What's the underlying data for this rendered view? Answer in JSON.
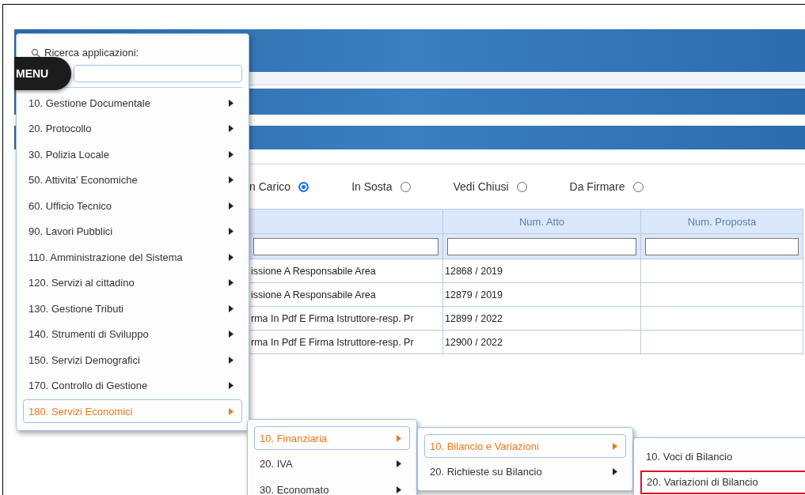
{
  "menu_badge": "MENU",
  "search": {
    "label": "Ricerca applicazioni:"
  },
  "filters": [
    {
      "label": "n Carico",
      "selected": true
    },
    {
      "label": "In Sosta",
      "selected": false
    },
    {
      "label": "Vedi Chiusi",
      "selected": false
    },
    {
      "label": "Da Firmare",
      "selected": false
    }
  ],
  "table": {
    "columns": [
      "Num. Atto",
      "Num. Proposta"
    ],
    "rows": [
      {
        "column_1": "issione A Responsabile Area",
        "num_atto": "12868 / 2019"
      },
      {
        "column_1": "issione A Responsabile Area",
        "num_atto": "12879 / 2019"
      },
      {
        "column_1": "rma In Pdf E Firma Istruttore-resp. Pr",
        "num_atto": "12899 / 2022"
      },
      {
        "column_1": "rma In Pdf E Firma Istruttore-resp. Pr",
        "num_atto": "12900 / 2022"
      }
    ]
  },
  "menus": [
    {
      "items": [
        {
          "label": "10. Gestione Documentale",
          "selected": false,
          "submenu": true,
          "outlined": false
        },
        {
          "label": "20. Protocollo",
          "selected": false,
          "submenu": true,
          "outlined": false
        },
        {
          "label": "30. Polizia Locale",
          "selected": false,
          "submenu": true,
          "outlined": false
        },
        {
          "label": "50. Attivita' Economiche",
          "selected": false,
          "submenu": true,
          "outlined": false
        },
        {
          "label": "60. Ufficio Tecnico",
          "selected": false,
          "submenu": true,
          "outlined": false
        },
        {
          "label": "90. Lavori Pubblici",
          "selected": false,
          "submenu": true,
          "outlined": false
        },
        {
          "label": "110. Amministrazione del Sistema",
          "selected": false,
          "submenu": true,
          "outlined": false
        },
        {
          "label": "120. Servizi al cittadino",
          "selected": false,
          "submenu": true,
          "outlined": false
        },
        {
          "label": "130. Gestione Tributi",
          "selected": false,
          "submenu": true,
          "outlined": false
        },
        {
          "label": "140. Strumenti di Sviluppo",
          "selected": false,
          "submenu": true,
          "outlined": false
        },
        {
          "label": "150. Servizi Demografici",
          "selected": false,
          "submenu": true,
          "outlined": false
        },
        {
          "label": "170. Controllo di Gestione",
          "selected": false,
          "submenu": true,
          "outlined": false
        },
        {
          "label": "180. Servizi Economici",
          "selected": true,
          "submenu": true,
          "outlined": false
        }
      ]
    },
    {
      "items": [
        {
          "label": "10. Finanziaria",
          "selected": true,
          "submenu": true,
          "outlined": false
        },
        {
          "label": "20. IVA",
          "selected": false,
          "submenu": true,
          "outlined": false
        },
        {
          "label": "30. Economato",
          "selected": false,
          "submenu": true,
          "outlined": false
        }
      ]
    },
    {
      "items": [
        {
          "label": "10. Bilancio e Variazioni",
          "selected": true,
          "submenu": true,
          "outlined": false
        },
        {
          "label": "20. Richieste su Bilancio",
          "selected": false,
          "submenu": true,
          "outlined": false
        }
      ]
    },
    {
      "items": [
        {
          "label": "10. Voci di Bilancio",
          "selected": false,
          "submenu": false,
          "outlined": false
        },
        {
          "label": "20. Variazioni di Bilancio",
          "selected": false,
          "submenu": false,
          "outlined": true
        }
      ]
    }
  ]
}
